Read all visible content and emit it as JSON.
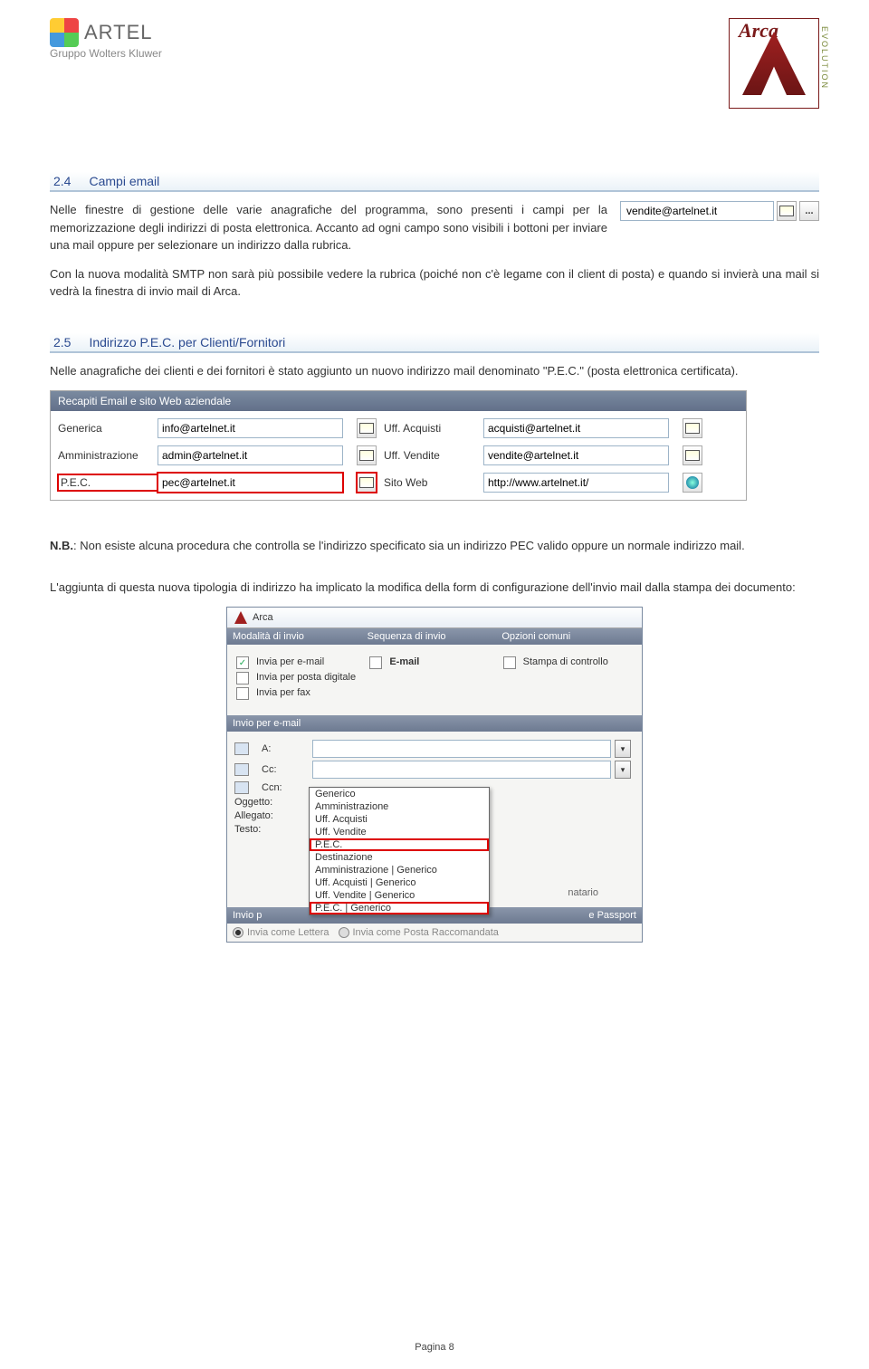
{
  "logos": {
    "artel": "ARTEL",
    "artel_sub": "Gruppo Wolters Kluwer",
    "arca": "Arca",
    "arca_side": "EVOLUTION"
  },
  "section24": {
    "num": "2.4",
    "title": "Campi email",
    "p1": "Nelle finestre di gestione delle varie anagrafiche del programma, sono presenti i campi per la memorizzazione degli indirizzi di posta elettronica. Accanto ad ogni campo sono visibili i bottoni per inviare una mail oppure per selezionare un indirizzo dalla rubrica.",
    "p2": "Con la nuova modalità SMTP non sarà più possibile vedere la rubrica (poiché non c'è legame con il client di posta) e quando si invierà una mail si vedrà la finestra di invio mail di Arca.",
    "sample_email": "vendite@artelnet.it"
  },
  "section25": {
    "num": "2.5",
    "title": "Indirizzo P.E.C. per Clienti/Fornitori",
    "p1": "Nelle anagrafiche dei clienti e dei fornitori è stato aggiunto un nuovo indirizzo mail denominato \"P.E.C.\" (posta elettronica certificata)."
  },
  "recapiti": {
    "title": "Recapiti Email e sito Web aziendale",
    "rows": {
      "generica_label": "Generica",
      "generica_value": "info@artelnet.it",
      "uff_acq_label": "Uff. Acquisti",
      "uff_acq_value": "acquisti@artelnet.it",
      "amm_label": "Amministrazione",
      "amm_value": "admin@artelnet.it",
      "uff_vend_label": "Uff. Vendite",
      "uff_vend_value": "vendite@artelnet.it",
      "pec_label": "P.E.C.",
      "pec_value": "pec@artelnet.it",
      "sito_label": "Sito Web",
      "sito_value": "http://www.artelnet.it/"
    }
  },
  "nb_label": "N.B.",
  "nb_text": ": Non esiste alcuna procedura che controlla se l'indirizzo specificato sia un indirizzo PEC valido oppure un normale indirizzo mail.",
  "p_form": "L'aggiunta di questa nuova tipologia di indirizzo ha implicato la modifica della form di configurazione dell'invio mail dalla stampa dei documento:",
  "dialog": {
    "title": "Arca",
    "bar1": {
      "c1": "Modalità di invio",
      "c2": "Sequenza di invio",
      "c3": "Opzioni comuni"
    },
    "chk_email": "Invia per e-mail",
    "chk_postadig": "Invia per posta digitale",
    "chk_fax": "Invia per fax",
    "seq_email": "E-mail",
    "opt_stampa": "Stampa di controllo",
    "bar2": "Invio per e-mail",
    "to": "A:",
    "cc": "Cc:",
    "ccn": "Ccn:",
    "ogg": "Oggetto:",
    "alleg": "Allegato:",
    "testo": "Testo:",
    "dd": {
      "generico": "Generico",
      "amm": "Amministrazione",
      "uffacq": "Uff. Acquisti",
      "uffvend": "Uff. Vendite",
      "pec": "P.E.C.",
      "dest": "Destinazione",
      "amm_gen": "Amministrazione | Generico",
      "uffacq_gen": "Uff. Acquisti | Generico",
      "uffvend_gen": "Uff. Vendite | Generico",
      "pec_gen": "P.E.C. | Generico"
    },
    "natario": "natario",
    "bar3_a": "Invio p",
    "bar3_b": "e Passport",
    "radio_lettera": "Invia come Lettera",
    "radio_racc": "Invia come Posta Raccomandata"
  },
  "footer": "Pagina 8"
}
